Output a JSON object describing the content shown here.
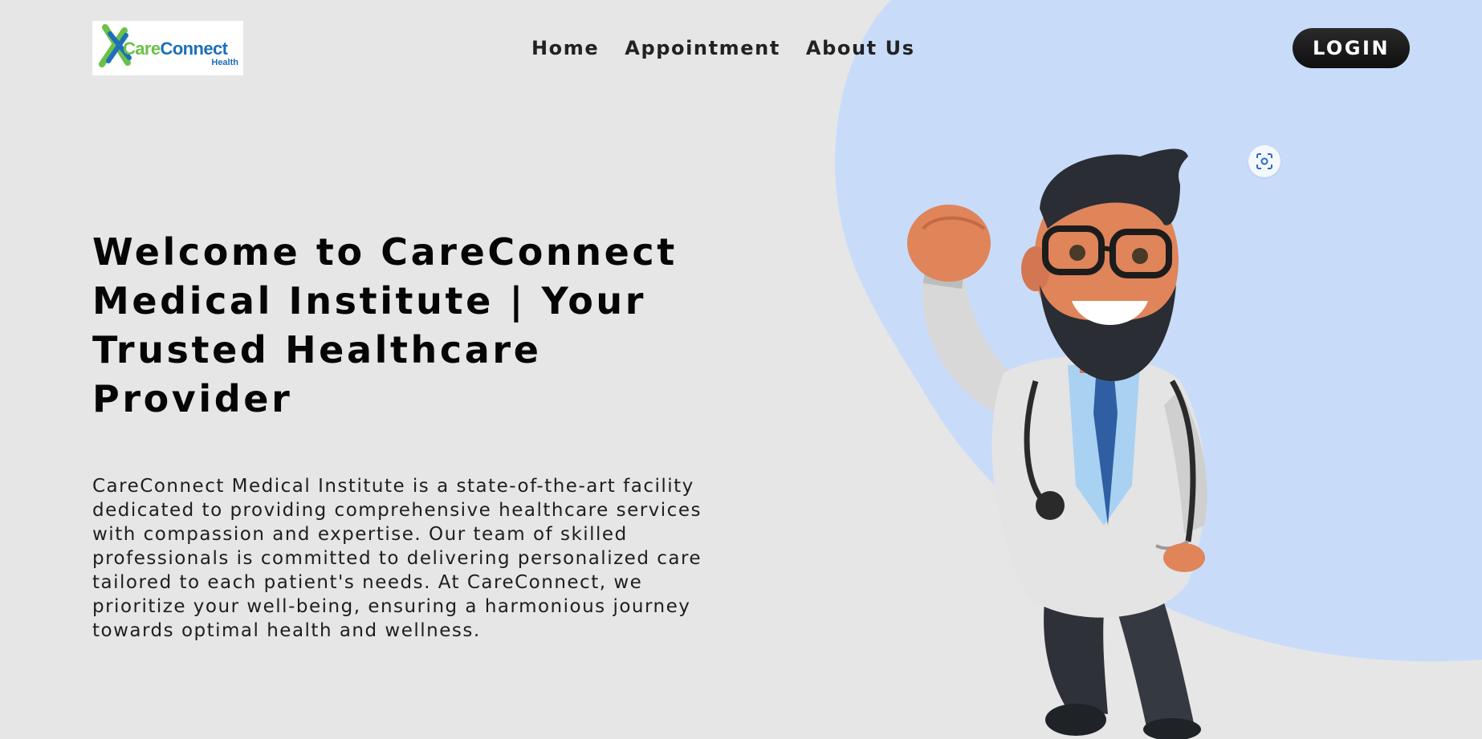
{
  "brand": {
    "name_part1": "Care",
    "name_part2": "Connect",
    "sub": "Health",
    "color_blue": "#1d6fb8",
    "color_green": "#6cc04a"
  },
  "nav": {
    "items": [
      {
        "label": "Home"
      },
      {
        "label": "Appointment"
      },
      {
        "label": "About Us"
      }
    ],
    "login_label": "LOGIN"
  },
  "hero": {
    "title": "Welcome to CareConnect Medical Institute | Your Trusted Healthcare Provider",
    "description": "CareConnect Medical Institute is a state-of-the-art facility dedicated to providing comprehensive healthcare services with compassion and expertise. Our team of skilled professionals is committed to delivering personalized care tailored to each patient's needs. At CareConnect, we prioritize your well-being, ensuring a harmonious journey towards optimal health and wellness."
  },
  "icons": {
    "lens": "visual-search-icon",
    "hero_image": "superhero-doctor-illustration"
  },
  "colors": {
    "background": "#e6e6e6",
    "accent_blob": "#c8dcf9",
    "text": "#050505",
    "button": "#111111"
  }
}
